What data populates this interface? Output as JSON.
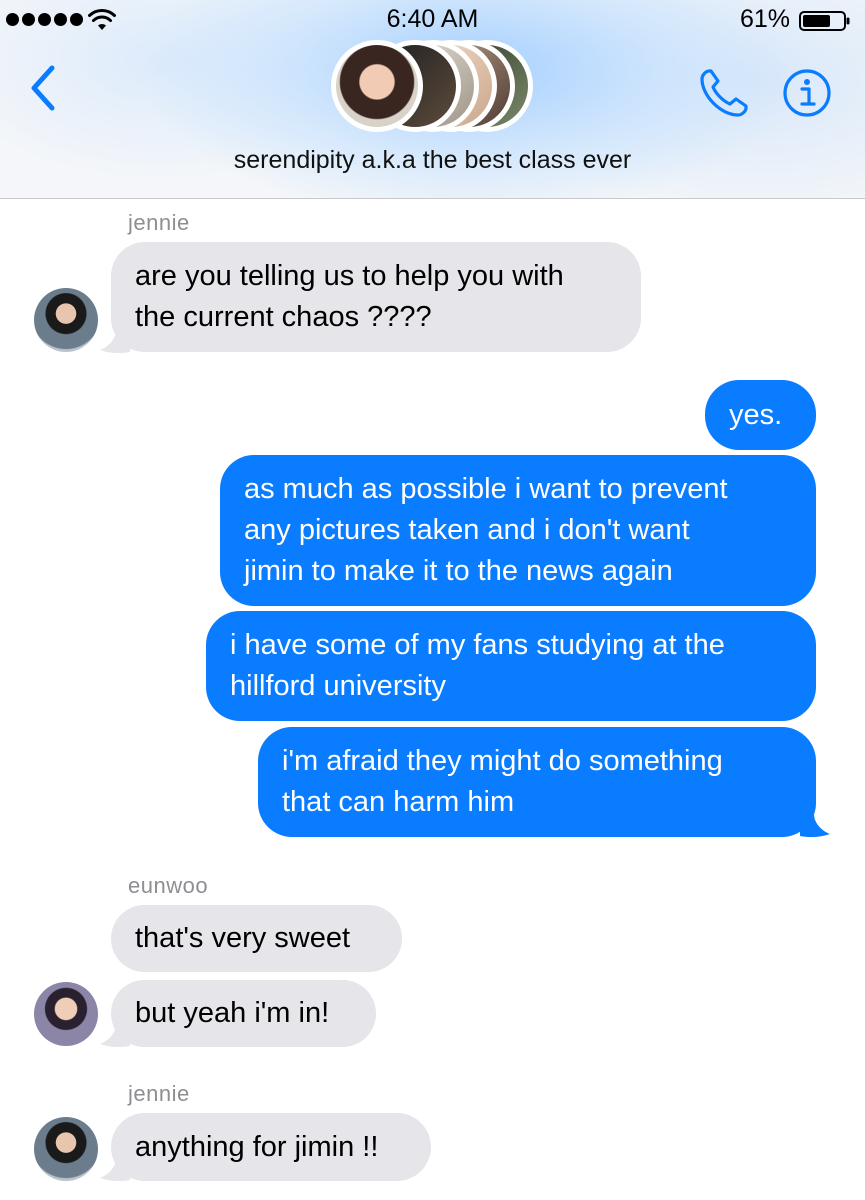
{
  "status_bar": {
    "time": "6:40 AM",
    "battery": "61%",
    "battery_level": 0.61,
    "signal_bars": 5
  },
  "header": {
    "group_name": "serendipity a.k.a the best class ever",
    "back_icon": "chevron-left-icon",
    "call_icon": "phone-icon",
    "info_icon": "info-icon",
    "accent_color": "#0a7cff"
  },
  "messages": [
    {
      "direction": "incoming",
      "sender": "jennie",
      "text": "are you telling us to help you with\nthe current chaos ????"
    },
    {
      "direction": "outgoing",
      "text": "yes."
    },
    {
      "direction": "outgoing",
      "text": "as much as possible i want to prevent\nany pictures taken and i don't want\njimin to make it to the news again"
    },
    {
      "direction": "outgoing",
      "text": "i have some of my fans studying at the\nhillford university"
    },
    {
      "direction": "outgoing",
      "text": "i'm afraid they might do something\nthat can harm him"
    },
    {
      "direction": "incoming",
      "sender": "eunwoo",
      "text": "that's very sweet"
    },
    {
      "direction": "incoming",
      "text": "but yeah i'm in!"
    },
    {
      "direction": "incoming",
      "sender": "jennie",
      "text": "anything for jimin !!"
    }
  ],
  "colors": {
    "incoming_bubble": "#e5e5ea",
    "outgoing_bubble": "#0a7cff",
    "sender_label": "#8e8e93"
  }
}
